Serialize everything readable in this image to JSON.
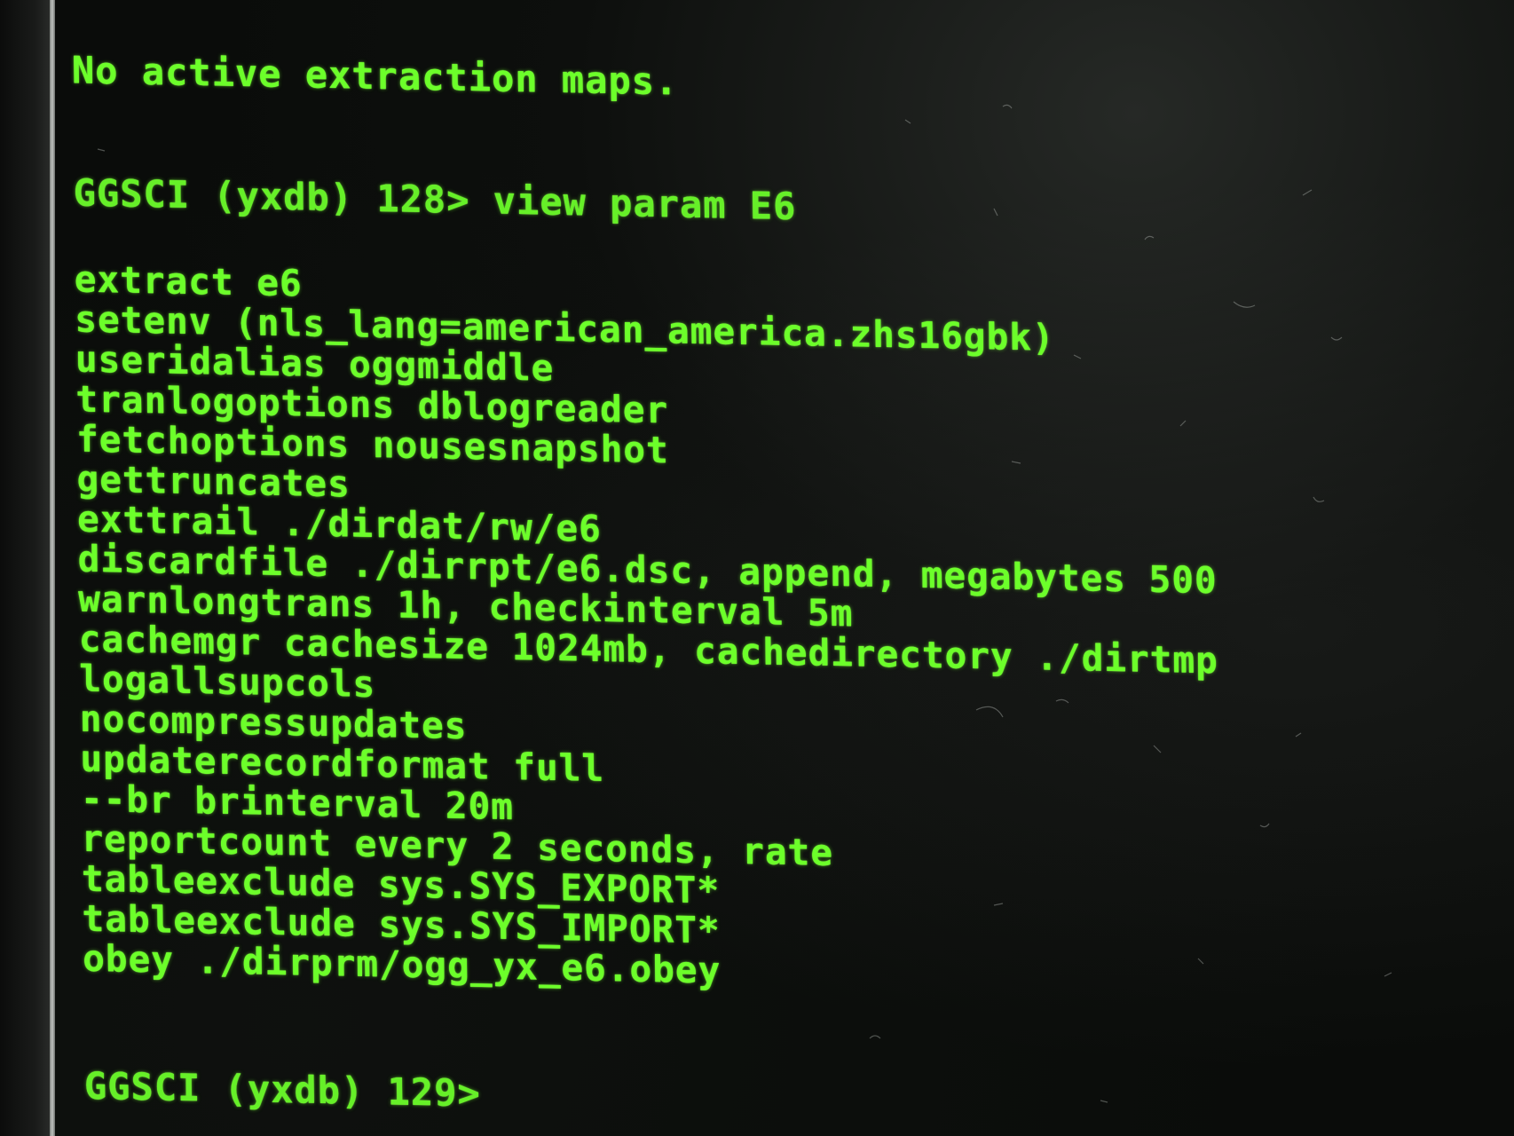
{
  "terminal": {
    "top_partial": "",
    "no_maps_message": "No active extraction maps.",
    "prompt_1": "GGSCI (yxdb) 128> view param E6",
    "param_lines": [
      "extract e6",
      "setenv (nls_lang=american_america.zhs16gbk)",
      "useridalias oggmiddle",
      "tranlogoptions dblogreader",
      "fetchoptions nousesnapshot",
      "gettruncates",
      "exttrail ./dirdat/rw/e6",
      "discardfile ./dirrpt/e6.dsc, append, megabytes 500",
      "warnlongtrans 1h, checkinterval 5m",
      "cachemgr cachesize 1024mb, cachedirectory ./dirtmp",
      "logallsupcols",
      "nocompressupdates",
      "updaterecordformat full",
      "--br brinterval 20m",
      "reportcount every 2 seconds, rate",
      "tableexclude sys.SYS_EXPORT*",
      "tableexclude sys.SYS_IMPORT*",
      "obey ./dirprm/ogg_yx_e6.obey"
    ],
    "prompt_2": "GGSCI (yxdb) 129>"
  },
  "colors": {
    "text": "#6cff2a",
    "background": "#0a0c0a"
  }
}
